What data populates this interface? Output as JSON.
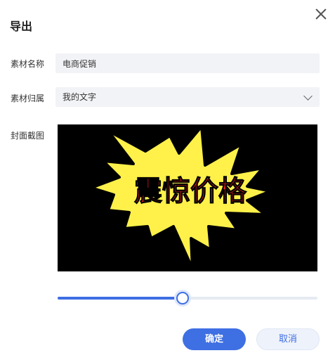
{
  "dialog": {
    "title": "导出"
  },
  "form": {
    "name_label": "素材名称",
    "name_value": "电商促销",
    "category_label": "素材归属",
    "category_value": "我的文字",
    "cover_label": "封面截图",
    "cover_text": "震惊价格"
  },
  "slider": {
    "value_percent": 48
  },
  "buttons": {
    "confirm": "确定",
    "cancel": "取消"
  },
  "colors": {
    "accent": "#3e6fe3",
    "burst_fill": "#fff14a",
    "burst_text": "#e81f2a",
    "cover_bg": "#000000"
  }
}
